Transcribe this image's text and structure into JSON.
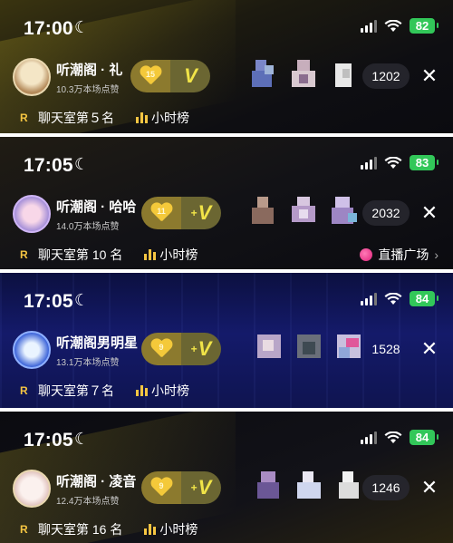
{
  "panels": [
    {
      "time": "17:00",
      "battery": "82",
      "host": {
        "name": "听潮阁 · 礼",
        "likes": "10.3万本场点赞",
        "avatar_text": ""
      },
      "badge": {
        "level": "15",
        "v_prefix": "",
        "v": "V"
      },
      "viewer_count": "1202",
      "rank_text": "聊天室第５名",
      "hour_text": "小时榜",
      "square_text": ""
    },
    {
      "time": "17:05",
      "battery": "83",
      "host": {
        "name": "听潮阁 · 哈哈",
        "likes": "14.0万本场点赞",
        "avatar_text": ""
      },
      "badge": {
        "level": "11",
        "v_prefix": "+",
        "v": "V"
      },
      "viewer_count": "2032",
      "rank_text": "聊天室第 10 名",
      "hour_text": "小时榜",
      "square_text": "直播广场"
    },
    {
      "time": "17:05",
      "battery": "84",
      "host": {
        "name": "听潮阁男明星",
        "likes": "13.1万本场点赞",
        "avatar_text": ""
      },
      "badge": {
        "level": "9",
        "v_prefix": "+",
        "v": "V"
      },
      "viewer_count": "1528",
      "rank_text": "聊天室第７名",
      "hour_text": "小时榜",
      "square_text": ""
    },
    {
      "time": "17:05",
      "battery": "84",
      "host": {
        "name": "听潮阁 · 凌音",
        "likes": "12.4万本场点赞",
        "avatar_text": ""
      },
      "badge": {
        "level": "9",
        "v_prefix": "+",
        "v": "V"
      },
      "viewer_count": "1246",
      "rank_text": "聊天室第 16 名",
      "hour_text": "小时榜",
      "square_text": ""
    }
  ],
  "icons": {
    "moon": "moon-icon",
    "close": "close-icon",
    "rank": "rank-icon",
    "hour": "bar-chart-icon",
    "square": "live-square-icon",
    "chevron": "chevron-right-icon"
  },
  "colors": {
    "accent": "#f5c542",
    "battery": "#32c759",
    "square_dot": "#e0207a"
  }
}
